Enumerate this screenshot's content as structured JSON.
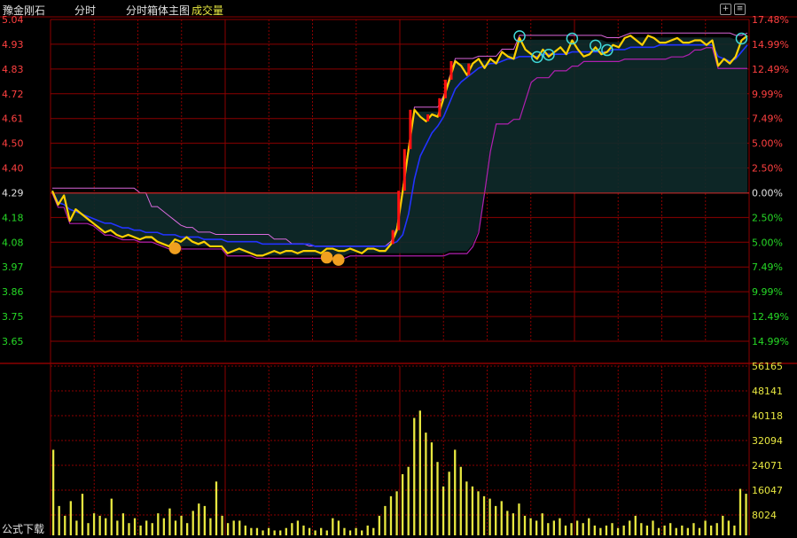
{
  "header": {
    "stock_name": "豫金刚石",
    "tab_intraday": "分时",
    "indicator_name": "分时箱体主图",
    "volume_label": "成交量"
  },
  "footer": {
    "formula_download": "公式下载"
  },
  "colors": {
    "background": "#000000",
    "grid": "#8b0000",
    "price_line": "#ffd000",
    "avg_line": "#2233ff",
    "box_fill": "#0e2a2a",
    "box_upper": "#ff77ff",
    "box_lower": "#b020b0",
    "pre_close_line": "#d22b2b",
    "rising_step": "#ff1111",
    "up_text": "#ff4040",
    "down_text": "#26d926",
    "flat_text": "#e0e0e0",
    "volume_bar": "#e8e840",
    "vol_axis_text": "#e8e840"
  },
  "chart_data": [
    {
      "type": "line",
      "title": "分时",
      "prev_close": 4.29,
      "ylim": [
        3.57,
        5.04
      ],
      "y_ticks_left": [
        "5.04",
        "4.93",
        "4.83",
        "4.72",
        "4.61",
        "4.50",
        "4.40",
        "4.29",
        "4.18",
        "4.08",
        "3.97",
        "3.86",
        "3.75",
        "3.65"
      ],
      "y_ticks_right": [
        "17.48%",
        "14.99%",
        "12.49%",
        "9.99%",
        "7.49%",
        "5.00%",
        "2.50%",
        "0.00%",
        "2.50%",
        "5.00%",
        "7.49%",
        "9.99%",
        "12.49%",
        "14.99%"
      ],
      "series": [
        {
          "key": "price",
          "values": [
            4.3,
            4.24,
            4.28,
            4.17,
            4.22,
            4.2,
            4.18,
            4.16,
            4.14,
            4.12,
            4.13,
            4.11,
            4.1,
            4.11,
            4.1,
            4.09,
            4.1,
            4.1,
            4.08,
            4.07,
            4.06,
            4.09,
            4.08,
            4.1,
            4.08,
            4.07,
            4.08,
            4.06,
            4.06,
            4.06,
            4.03,
            4.04,
            4.05,
            4.04,
            4.03,
            4.02,
            4.02,
            4.03,
            4.04,
            4.03,
            4.04,
            4.04,
            4.03,
            4.04,
            4.04,
            4.04,
            4.03,
            4.05,
            4.05,
            4.04,
            4.04,
            4.05,
            4.04,
            4.03,
            4.05,
            4.05,
            4.04,
            4.04,
            4.07,
            4.13,
            4.3,
            4.48,
            4.65,
            4.62,
            4.6,
            4.63,
            4.62,
            4.7,
            4.78,
            4.86,
            4.84,
            4.8,
            4.85,
            4.87,
            4.83,
            4.87,
            4.85,
            4.9,
            4.88,
            4.87,
            4.96,
            4.91,
            4.89,
            4.87,
            4.91,
            4.88,
            4.9,
            4.92,
            4.89,
            4.95,
            4.91,
            4.88,
            4.89,
            4.92,
            4.89,
            4.9,
            4.93,
            4.92,
            4.96,
            4.97,
            4.95,
            4.93,
            4.97,
            4.96,
            4.94,
            4.94,
            4.95,
            4.96,
            4.94,
            4.94,
            4.95,
            4.95,
            4.93,
            4.95,
            4.84,
            4.87,
            4.85,
            4.88,
            4.95,
            4.97
          ]
        },
        {
          "key": "average",
          "values": [
            4.3,
            4.25,
            4.24,
            4.22,
            4.21,
            4.2,
            4.19,
            4.18,
            4.17,
            4.16,
            4.16,
            4.15,
            4.14,
            4.14,
            4.13,
            4.13,
            4.12,
            4.12,
            4.12,
            4.11,
            4.11,
            4.11,
            4.1,
            4.1,
            4.1,
            4.1,
            4.09,
            4.09,
            4.09,
            4.09,
            4.08,
            4.08,
            4.08,
            4.08,
            4.08,
            4.08,
            4.07,
            4.07,
            4.07,
            4.07,
            4.07,
            4.07,
            4.07,
            4.07,
            4.07,
            4.06,
            4.06,
            4.06,
            4.06,
            4.06,
            4.06,
            4.06,
            4.06,
            4.06,
            4.06,
            4.06,
            4.06,
            4.06,
            4.07,
            4.08,
            4.11,
            4.2,
            4.35,
            4.45,
            4.5,
            4.55,
            4.58,
            4.62,
            4.68,
            4.74,
            4.77,
            4.79,
            4.81,
            4.83,
            4.84,
            4.85,
            4.85,
            4.86,
            4.87,
            4.87,
            4.88,
            4.88,
            4.88,
            4.88,
            4.89,
            4.89,
            4.89,
            4.89,
            4.89,
            4.9,
            4.9,
            4.9,
            4.9,
            4.9,
            4.9,
            4.9,
            4.91,
            4.91,
            4.91,
            4.92,
            4.92,
            4.92,
            4.92,
            4.92,
            4.93,
            4.93,
            4.93,
            4.93,
            4.93,
            4.93,
            4.93,
            4.93,
            4.93,
            4.93,
            4.88,
            4.87,
            4.86,
            4.87,
            4.9,
            4.93
          ]
        }
      ],
      "volume": {
        "y_ticks": [
          "56165",
          "48141",
          "40118",
          "32094",
          "24071",
          "16047",
          "8024"
        ],
        "ymax": 56165,
        "values": [
          35000,
          12000,
          8000,
          14000,
          6000,
          17000,
          5000,
          9000,
          8000,
          7000,
          15000,
          6000,
          9000,
          5000,
          7000,
          4000,
          6000,
          5000,
          9000,
          7000,
          11000,
          6000,
          8000,
          5000,
          10000,
          13000,
          12000,
          7000,
          22000,
          8000,
          5000,
          6000,
          6000,
          4000,
          3000,
          3000,
          2000,
          3000,
          2000,
          2000,
          3000,
          5000,
          6000,
          4000,
          3000,
          2000,
          3000,
          2000,
          7000,
          6000,
          3000,
          2000,
          3000,
          2000,
          4000,
          3000,
          8000,
          12000,
          16000,
          18000,
          25000,
          28000,
          48000,
          51000,
          42000,
          38000,
          30000,
          20000,
          26000,
          35000,
          28000,
          22000,
          20000,
          18000,
          16000,
          15000,
          12000,
          14000,
          10000,
          9000,
          13000,
          8000,
          7000,
          6000,
          9000,
          5000,
          6000,
          7000,
          4000,
          5000,
          6000,
          5000,
          7000,
          4000,
          3000,
          4000,
          5000,
          3000,
          4000,
          6000,
          8000,
          5000,
          4000,
          6000,
          3000,
          4000,
          5000,
          3000,
          4000,
          3000,
          5000,
          3000,
          6000,
          4000,
          5000,
          8000,
          6000,
          4000,
          19000,
          17000
        ]
      }
    }
  ]
}
